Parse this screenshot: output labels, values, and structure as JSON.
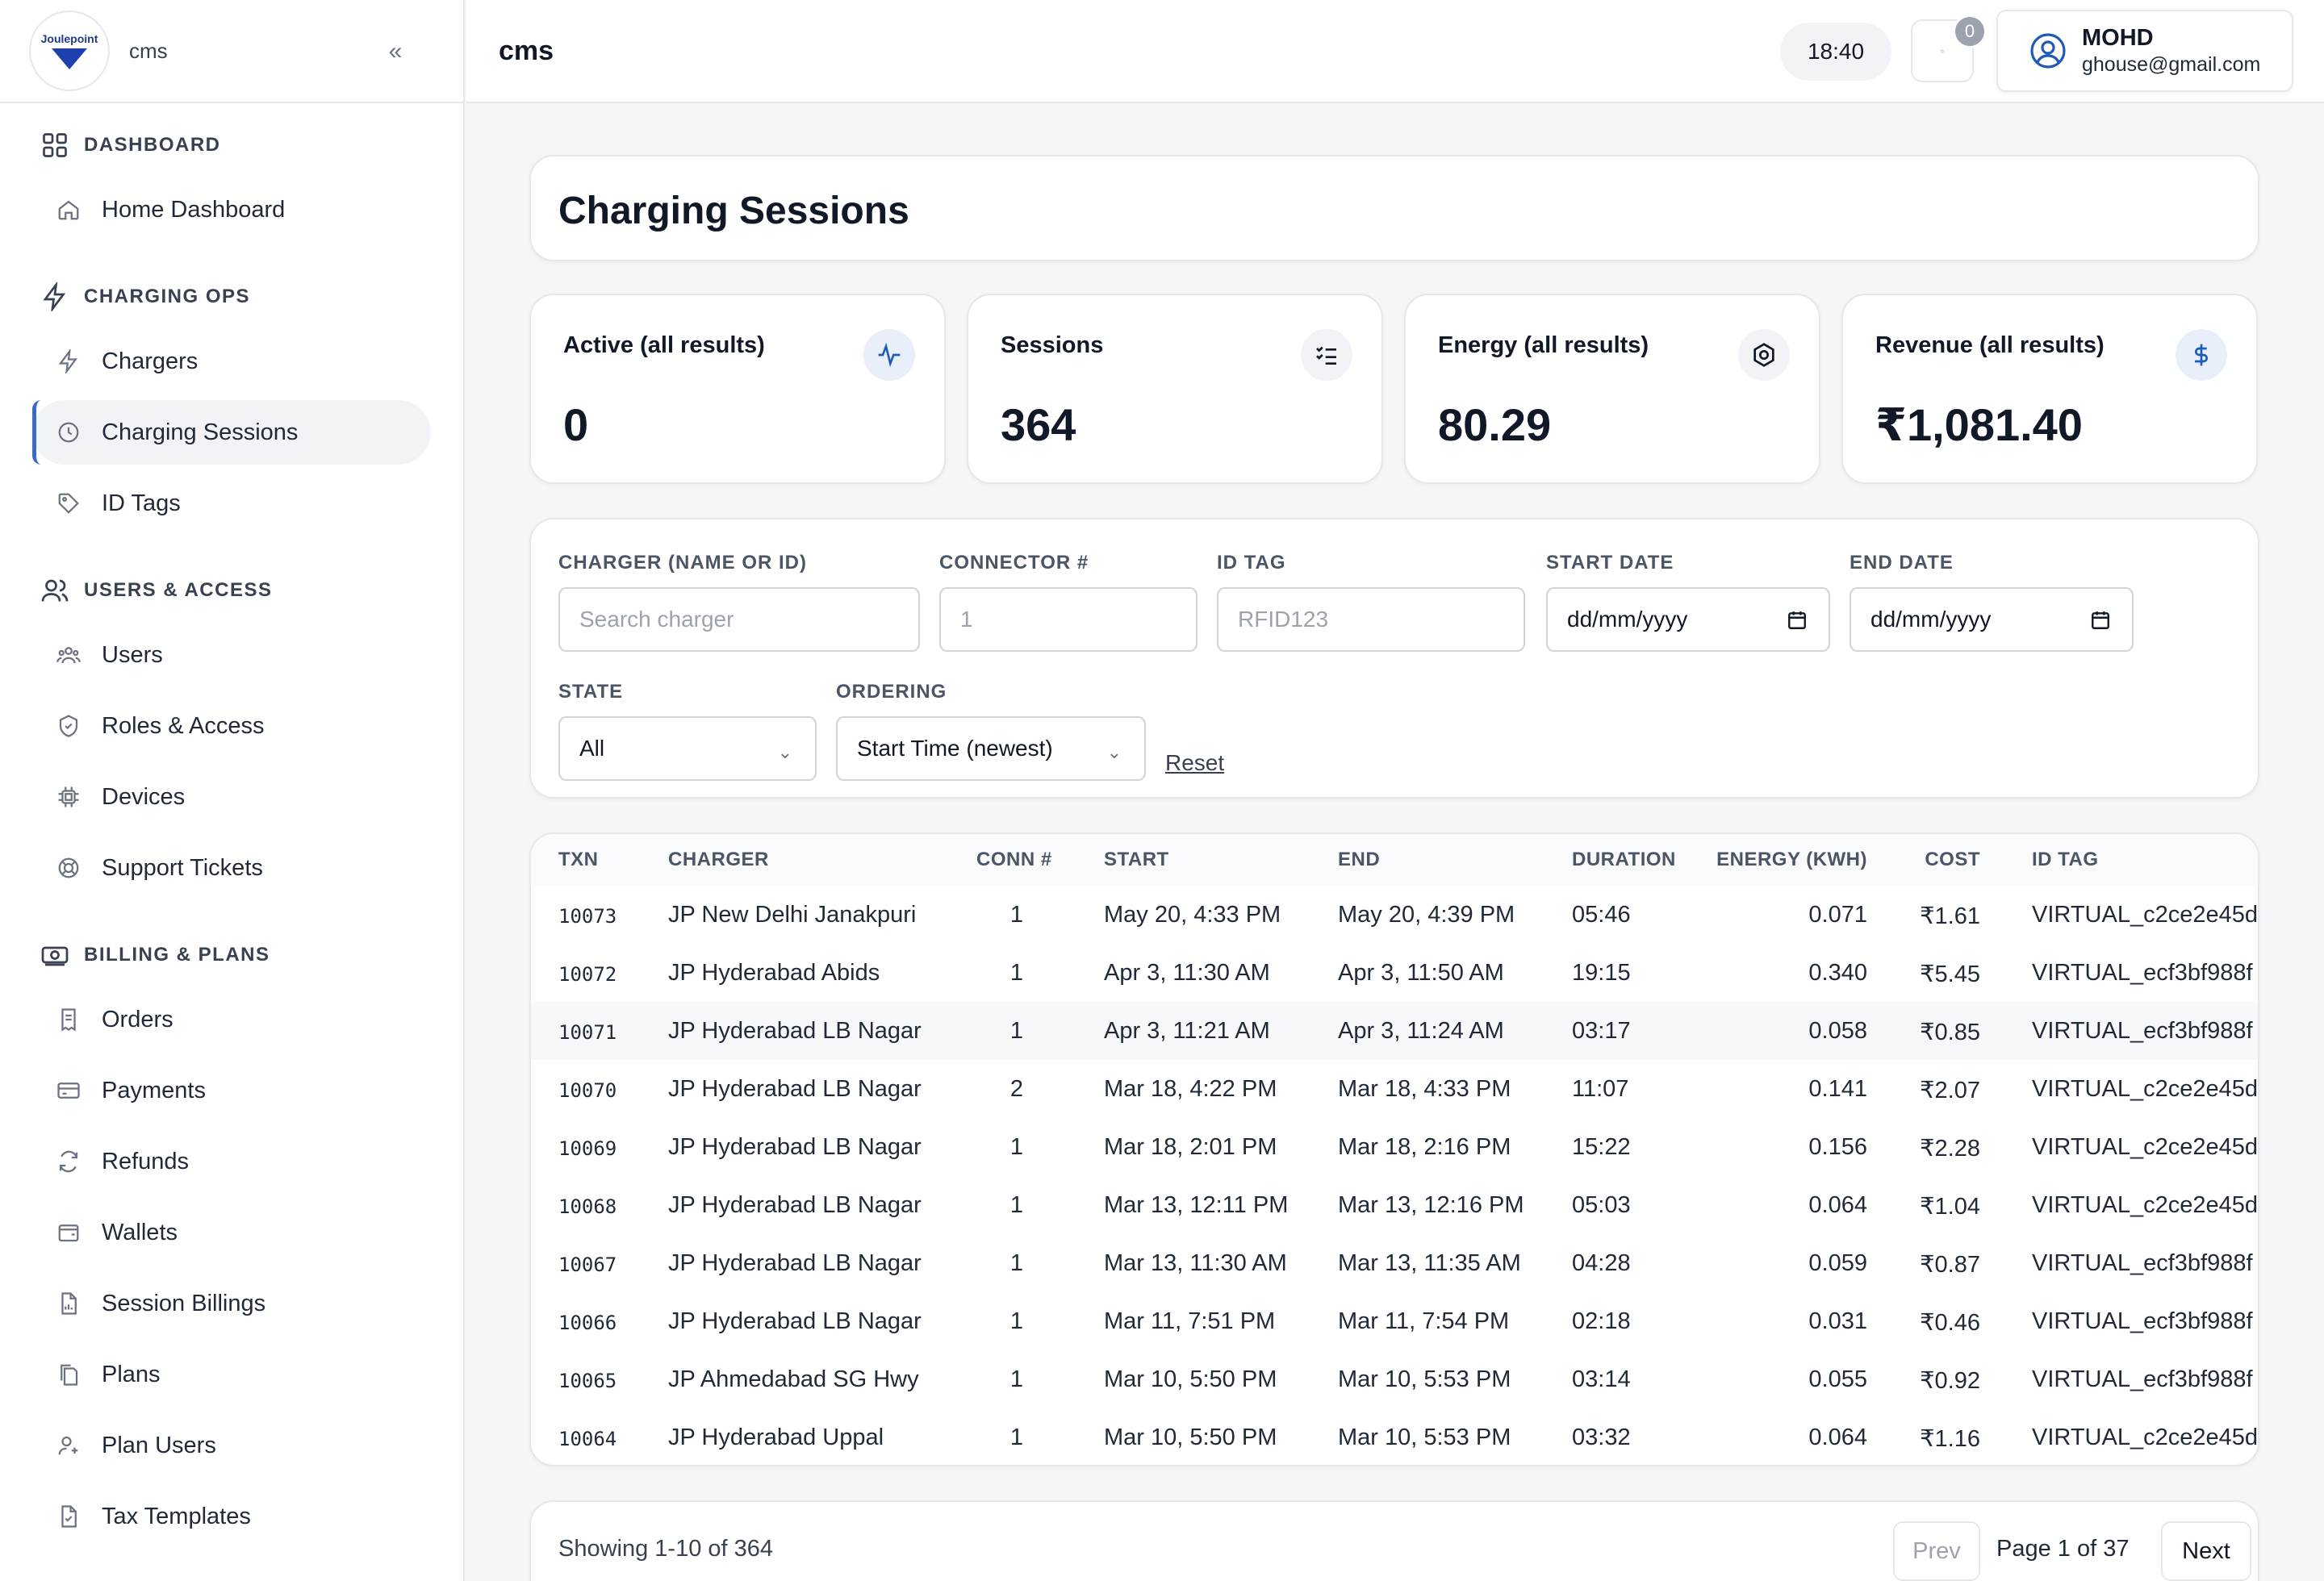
{
  "sidebar": {
    "logo_text": "Joulepoint",
    "app_name": "cms",
    "sections": [
      {
        "label": "DASHBOARD",
        "items": [
          "Home Dashboard"
        ]
      },
      {
        "label": "CHARGING OPS",
        "items": [
          "Chargers",
          "Charging Sessions",
          "ID Tags"
        ]
      },
      {
        "label": "USERS & ACCESS",
        "items": [
          "Users",
          "Roles & Access",
          "Devices",
          "Support Tickets"
        ]
      },
      {
        "label": "BILLING & PLANS",
        "items": [
          "Orders",
          "Payments",
          "Refunds",
          "Wallets",
          "Session Billings",
          "Plans",
          "Plan Users",
          "Tax Templates"
        ]
      }
    ],
    "active_item": "Charging Sessions"
  },
  "topbar": {
    "title": "cms",
    "time": "18:40",
    "notifications": "0",
    "user_name": "MOHD",
    "user_email": "ghouse@gmail.com"
  },
  "page": {
    "title": "Charging Sessions"
  },
  "stats": [
    {
      "label": "Active (all results)",
      "value": "0",
      "icon": "activity-icon"
    },
    {
      "label": "Sessions",
      "value": "364",
      "icon": "list-check-icon"
    },
    {
      "label": "Energy (all results)",
      "value": "80.29",
      "icon": "gear-icon"
    },
    {
      "label": "Revenue (all results)",
      "value": "₹1,081.40",
      "icon": "dollar-icon"
    }
  ],
  "filters": {
    "charger_label": "CHARGER (NAME OR ID)",
    "charger_placeholder": "Search charger",
    "connector_label": "CONNECTOR #",
    "connector_placeholder": "1",
    "idtag_label": "ID TAG",
    "idtag_placeholder": "RFID123",
    "start_label": "START DATE",
    "start_value": "dd/mm/yyyy",
    "end_label": "END DATE",
    "end_value": "dd/mm/yyyy",
    "state_label": "STATE",
    "state_value": "All",
    "ordering_label": "ORDERING",
    "ordering_value": "Start Time (newest)",
    "reset_label": "Reset"
  },
  "table": {
    "headers": [
      "TXN",
      "CHARGER",
      "CONN #",
      "START",
      "END",
      "DURATION",
      "ENERGY (KWH)",
      "COST",
      "ID TAG"
    ],
    "rows": [
      [
        "10073",
        "JP New Delhi Janakpuri",
        "1",
        "May 20, 4:33 PM",
        "May 20, 4:39 PM",
        "05:46",
        "0.071",
        "₹1.61",
        "VIRTUAL_c2ce2e45d"
      ],
      [
        "10072",
        "JP Hyderabad Abids",
        "1",
        "Apr 3, 11:30 AM",
        "Apr 3, 11:50 AM",
        "19:15",
        "0.340",
        "₹5.45",
        "VIRTUAL_ecf3bf988f"
      ],
      [
        "10071",
        "JP Hyderabad LB Nagar",
        "1",
        "Apr 3, 11:21 AM",
        "Apr 3, 11:24 AM",
        "03:17",
        "0.058",
        "₹0.85",
        "VIRTUAL_ecf3bf988f"
      ],
      [
        "10070",
        "JP Hyderabad LB Nagar",
        "2",
        "Mar 18, 4:22 PM",
        "Mar 18, 4:33 PM",
        "11:07",
        "0.141",
        "₹2.07",
        "VIRTUAL_c2ce2e45d"
      ],
      [
        "10069",
        "JP Hyderabad LB Nagar",
        "1",
        "Mar 18, 2:01 PM",
        "Mar 18, 2:16 PM",
        "15:22",
        "0.156",
        "₹2.28",
        "VIRTUAL_c2ce2e45d"
      ],
      [
        "10068",
        "JP Hyderabad LB Nagar",
        "1",
        "Mar 13, 12:11 PM",
        "Mar 13, 12:16 PM",
        "05:03",
        "0.064",
        "₹1.04",
        "VIRTUAL_c2ce2e45d"
      ],
      [
        "10067",
        "JP Hyderabad LB Nagar",
        "1",
        "Mar 13, 11:30 AM",
        "Mar 13, 11:35 AM",
        "04:28",
        "0.059",
        "₹0.87",
        "VIRTUAL_ecf3bf988f"
      ],
      [
        "10066",
        "JP Hyderabad LB Nagar",
        "1",
        "Mar 11, 7:51 PM",
        "Mar 11, 7:54 PM",
        "02:18",
        "0.031",
        "₹0.46",
        "VIRTUAL_ecf3bf988f"
      ],
      [
        "10065",
        "JP Ahmedabad SG Hwy",
        "1",
        "Mar 10, 5:50 PM",
        "Mar 10, 5:53 PM",
        "03:14",
        "0.055",
        "₹0.92",
        "VIRTUAL_ecf3bf988f"
      ],
      [
        "10064",
        "JP Hyderabad Uppal",
        "1",
        "Mar 10, 5:50 PM",
        "Mar 10, 5:53 PM",
        "03:32",
        "0.064",
        "₹1.16",
        "VIRTUAL_c2ce2e45d"
      ]
    ]
  },
  "pager": {
    "showing": "Showing 1-10 of 364",
    "prev": "Prev",
    "page_info": "Page 1 of 37",
    "next": "Next"
  },
  "colors": {
    "accent": "#3b6bc9",
    "icon_blue_bg": "#e8effa",
    "icon_gray_bg": "#f1f3f6"
  }
}
